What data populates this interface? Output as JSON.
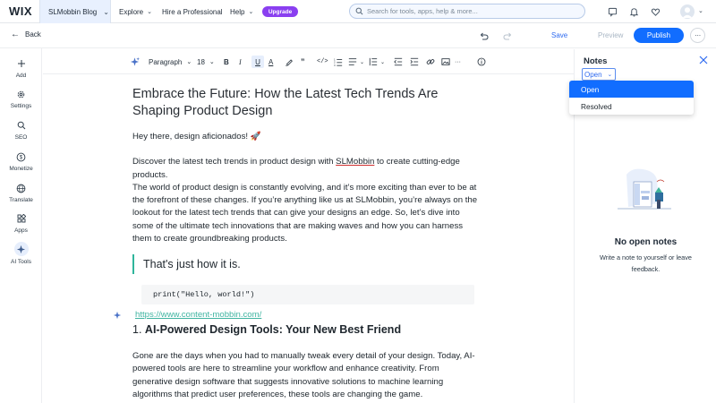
{
  "topbar": {
    "logo": "WIX",
    "site_name": "SLMobbin Blog",
    "nav": [
      "Explore",
      "Hire a Professional",
      "Help"
    ],
    "upgrade_label": "Upgrade",
    "search_placeholder": "Search for tools, apps, help & more...",
    "icons": [
      "chat-icon",
      "bell-icon",
      "heart-icon"
    ]
  },
  "subbar": {
    "back_label": "Back",
    "save_label": "Save",
    "preview_label": "Preview",
    "publish_label": "Publish",
    "more_label": "···"
  },
  "sidebar": {
    "items": [
      {
        "label": "Add",
        "icon": "plus-icon"
      },
      {
        "label": "Settings",
        "icon": "gear-icon"
      },
      {
        "label": "SEO",
        "icon": "search-icon"
      },
      {
        "label": "Monetize",
        "icon": "dollar-icon"
      },
      {
        "label": "Translate",
        "icon": "globe-icon"
      },
      {
        "label": "Apps",
        "icon": "apps-icon"
      },
      {
        "label": "AI Tools",
        "icon": "sparkle-icon"
      }
    ]
  },
  "toolbar": {
    "text_style": "Paragraph",
    "font_size": "18"
  },
  "editor": {
    "title": "Embrace the Future: How the Latest Tech Trends Are Shaping Product Design",
    "greeting": "Hey there, design aficionados! 🚀",
    "para1_before": "Discover the latest tech trends in product design with ",
    "para1_link": "SLMobbin",
    "para1_after": " to create cutting-edge products.",
    "para2": "The world of product design is constantly evolving, and it’s more exciting than ever to be at the forefront of these changes. If you’re anything like us at SLMobbin, you’re always on the lookout for the latest tech trends that can give your designs an edge. So, let’s dive into some of the ultimate tech innovations that are making waves and how you can harness them to create groundbreaking products.",
    "quote": "That's just how it is.",
    "code": "print(\"Hello, world!\")",
    "url": "https://www.content-mobbin.com/",
    "heading_number": "1.",
    "heading": "AI-Powered Design Tools: Your New Best Friend",
    "para3": "Gone are the days when you had to manually tweak every detail of your design. Today, AI-powered tools are here to streamline your workflow and enhance creativity. From generative design software that suggests innovative solutions to machine learning algorithms that predict user preferences, these tools are changing the game."
  },
  "notes_panel": {
    "title": "Notes",
    "filter_value": "Open",
    "options": [
      "Open",
      "Resolved"
    ],
    "empty_title": "No open notes",
    "empty_desc": "Write a note to yourself or leave feedback."
  },
  "colors": {
    "accent": "#116dff",
    "upgrade": "#8a3ff0",
    "quote_bar": "#2fb59b",
    "link": "#3fb4a1"
  }
}
